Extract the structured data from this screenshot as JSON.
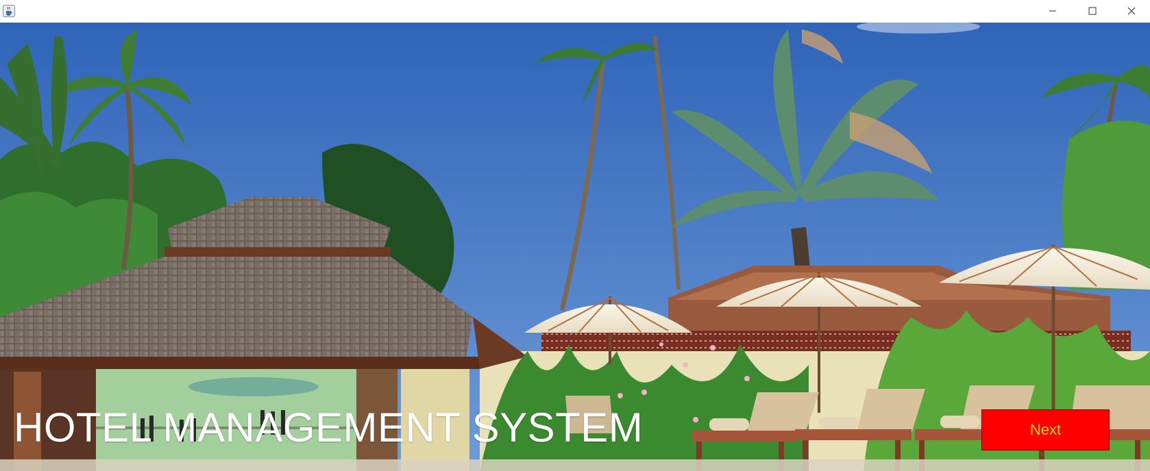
{
  "window": {
    "icons": {
      "app": "java-cup-icon",
      "minimize": "minimize-icon",
      "maximize": "maximize-icon",
      "close": "close-icon"
    }
  },
  "main": {
    "title": "HOTEL MANAGEMENT SYSTEM",
    "next_label": "Next",
    "background": "hotel-resort-photo"
  },
  "colors": {
    "next_button_bg": "#ff0000",
    "next_button_text": "#ffd400",
    "title_text": "#ffffff",
    "sky": "#3c72c4"
  }
}
